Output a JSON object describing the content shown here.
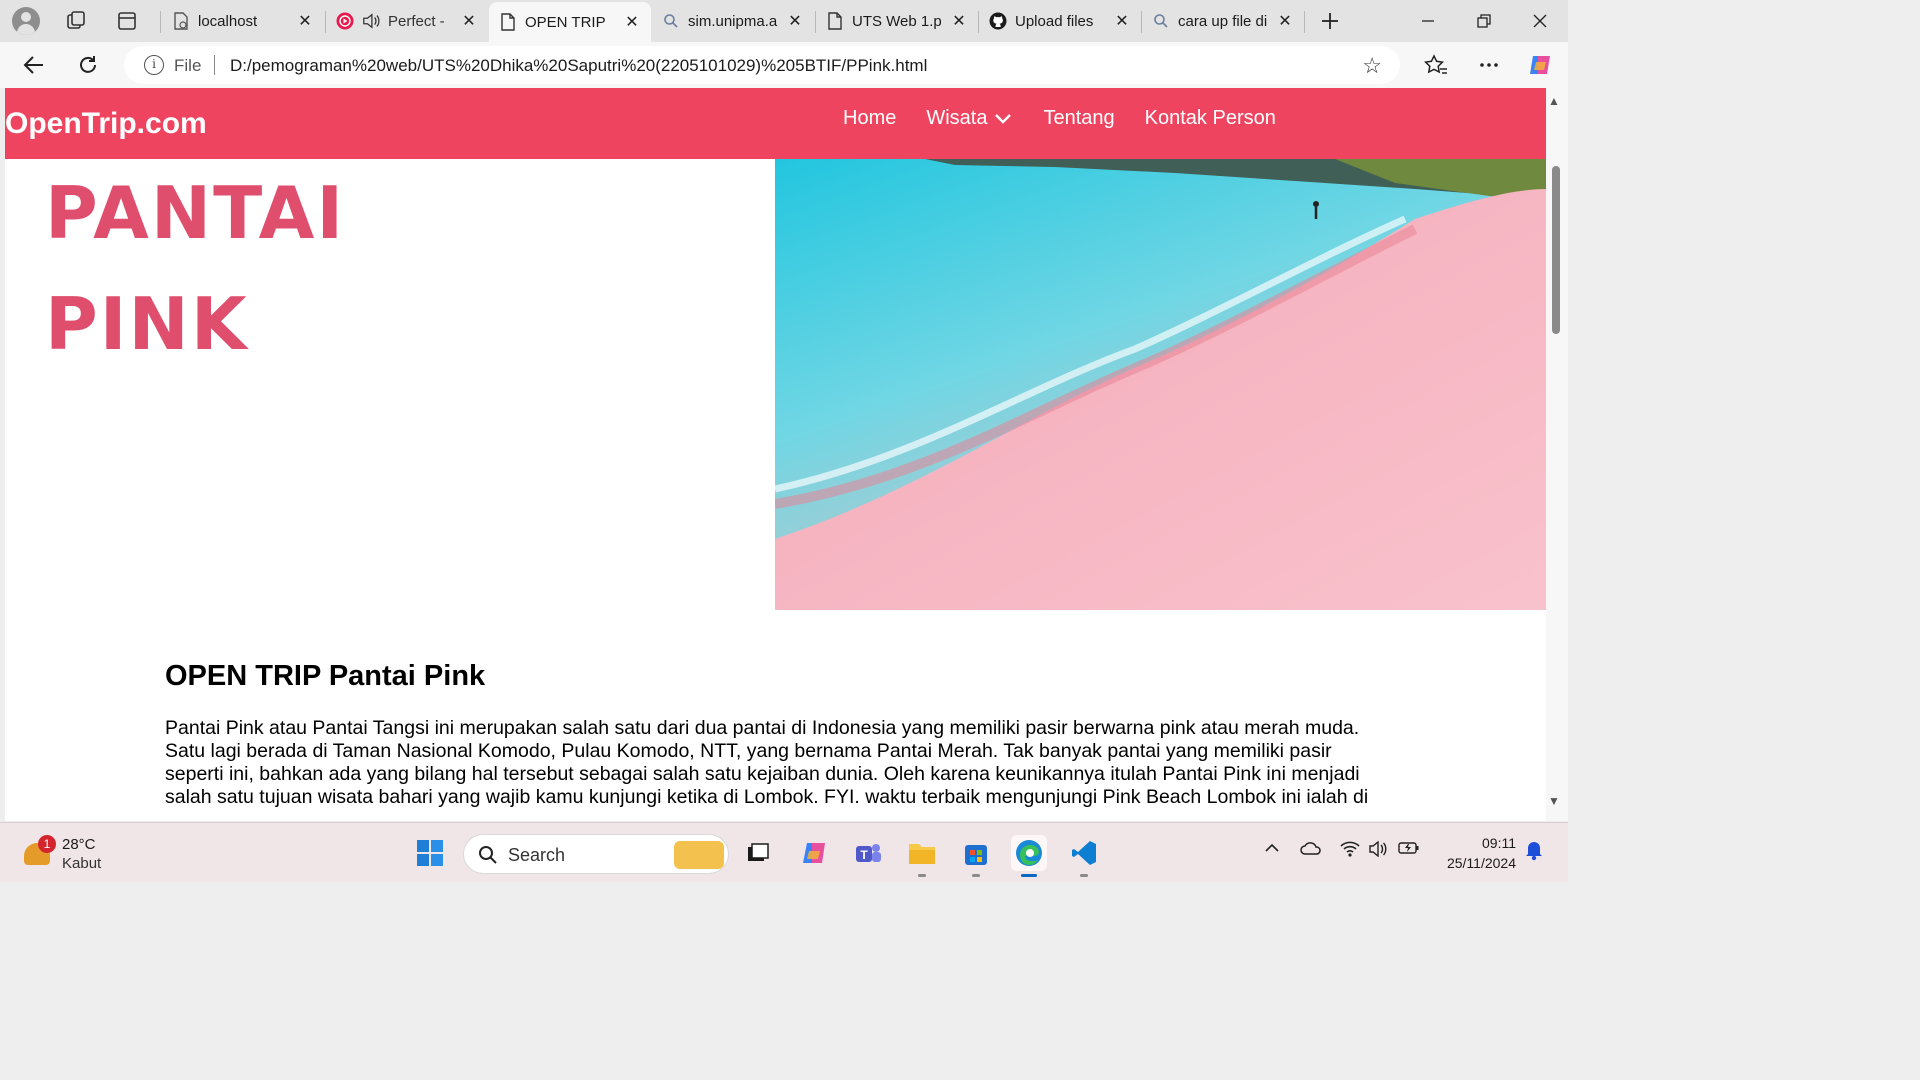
{
  "browser": {
    "tabs": [
      {
        "title": "localhost",
        "icon": "page-error-icon",
        "active": false
      },
      {
        "title": "Perfect -",
        "icon": "music-icon",
        "active": false,
        "audio": true
      },
      {
        "title": "OPEN TRIP",
        "icon": "page-icon",
        "active": true
      },
      {
        "title": "sim.unipma.a",
        "icon": "search-icon",
        "active": false
      },
      {
        "title": "UTS Web 1.p",
        "icon": "page-icon",
        "active": false
      },
      {
        "title": "Upload files",
        "icon": "github-icon",
        "active": false
      },
      {
        "title": "cara up file di",
        "icon": "search-icon",
        "active": false
      }
    ],
    "address": {
      "scheme_label": "File",
      "url": "D:/pemograman%20web/UTS%20Dhika%20Saputri%20(2205101029)%205BTIF/PPink.html"
    }
  },
  "site": {
    "brand": "OpenTrip.com",
    "nav": [
      "Home",
      "Wisata",
      "Tentang",
      "Kontak Person"
    ],
    "hero_title_line1": "PANTAI",
    "hero_title_line2": "PINK",
    "section_title": "OPEN TRIP Pantai Pink",
    "section_text": "Pantai Pink atau Pantai Tangsi ini merupakan salah satu dari dua pantai di Indonesia yang memiliki pasir berwarna pink atau merah muda. Satu lagi berada di Taman Nasional Komodo, Pulau Komodo, NTT, yang bernama Pantai Merah. Tak banyak pantai yang memiliki pasir seperti ini, bahkan ada yang bilang hal tersebut sebagai salah satu kejaiban dunia. Oleh karena keunikannya itulah Pantai Pink ini menjadi salah satu tujuan wisata bahari yang wajib kamu kunjungi ketika di Lombok. FYI. waktu terbaik mengunjungi Pink Beach Lombok ini ialah di"
  },
  "taskbar": {
    "weather_temp": "28°C",
    "weather_cond": "Kabut",
    "weather_badge": "1",
    "search_label": "Search",
    "time": "09:11",
    "date": "25/11/2024"
  },
  "colors": {
    "nav_bg": "#ee4460",
    "hero_title": "#e04e6e",
    "accent": "#0b67c4"
  }
}
